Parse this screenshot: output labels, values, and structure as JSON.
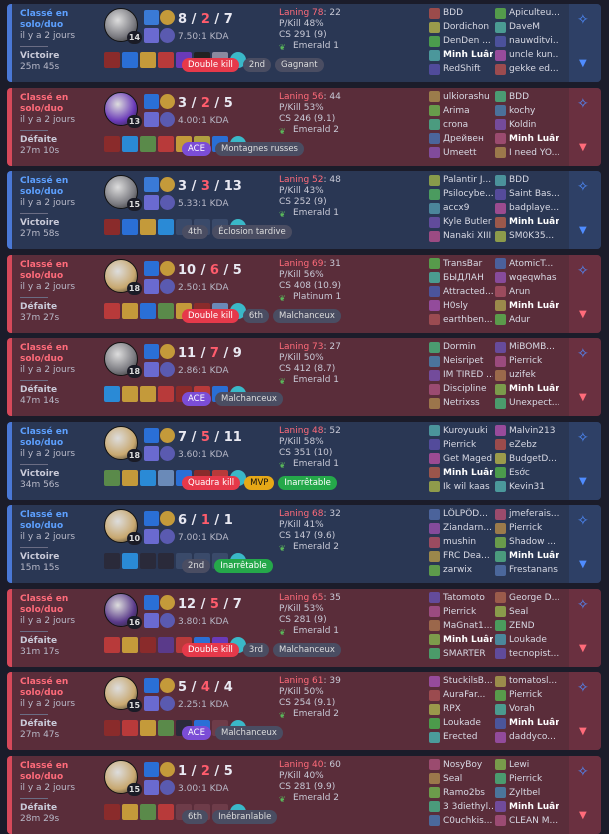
{
  "matches": [
    {
      "result": "win",
      "queue": "Classé en solo/duo",
      "ago": "il y a 2 jours",
      "outcome": "Victoire",
      "duration": "25m 45s",
      "level": "14",
      "kills": "8",
      "deaths": "2",
      "assists": "7",
      "kda_ratio": "7.50:1 KDA",
      "laning": "Laning 78",
      "laning_b": ": 22",
      "pkill": "P/Kill 48%",
      "cs": "CS 291 (9)",
      "rank": "Emerald 1",
      "badges": [
        {
          "t": "Double kill",
          "c": "red"
        },
        {
          "t": "2nd",
          "c": "grey"
        },
        {
          "t": "Gagnant",
          "c": "grey"
        }
      ],
      "team1": [
        "BDD",
        "Dordichon",
        "DenDen ...",
        "Minh Luân",
        "RedShift"
      ],
      "team2": [
        "Apiculteu...",
        "DaveM",
        "nauwditvi...",
        "uncle kun...",
        "gekke ed..."
      ],
      "items": [
        "#8a2b2b",
        "#2a6fd6",
        "#c49a3a",
        "#b83a3a",
        "#6a3ab8",
        "#222",
        "#8a8aa0"
      ],
      "ward": "#3ab8c8",
      "champ": "#7a7a80",
      "s1": "#3a7ad6",
      "s2": "#c49a3a"
    },
    {
      "result": "loss",
      "queue": "Classé en solo/duo",
      "ago": "il y a 2 jours",
      "outcome": "Défaite",
      "duration": "27m 10s",
      "level": "13",
      "kills": "3",
      "deaths": "2",
      "assists": "5",
      "kda_ratio": "4.00:1 KDA",
      "laning": "Laning 56",
      "laning_b": ": 44",
      "pkill": "P/Kill 53%",
      "cs": "CS 246 (9.1)",
      "rank": "Emerald 2",
      "badges": [
        {
          "t": "ACE",
          "c": "purple"
        },
        {
          "t": "Montagnes russes",
          "c": "grey"
        }
      ],
      "team1": [
        "ulkiorashu",
        "Arima",
        "crona",
        "Дрейвен",
        "Umeett"
      ],
      "team2": [
        "BDD",
        "kochy",
        "Koldin",
        "Minh Luân",
        "I need YO..."
      ],
      "items": [
        "#8a2b2b",
        "#2a8ad6",
        "#5a8a4a",
        "#b83a3a",
        "#c49a3a",
        "#b0a040",
        "#2a6fd6"
      ],
      "ward": "#3ab8c8",
      "champ": "#6a3ab8",
      "s1": "#2a6fd6",
      "s2": "#c49a3a"
    },
    {
      "result": "win",
      "queue": "Classé en solo/duo",
      "ago": "il y a 2 jours",
      "outcome": "Victoire",
      "duration": "27m 58s",
      "level": "15",
      "kills": "3",
      "deaths": "3",
      "assists": "13",
      "kda_ratio": "5.33:1 KDA",
      "laning": "Laning 52",
      "laning_b": ": 48",
      "pkill": "P/Kill 43%",
      "cs": "CS 252 (9)",
      "rank": "Emerald 1",
      "badges": [
        {
          "t": "4th",
          "c": "grey"
        },
        {
          "t": "Éclosion tardive",
          "c": "grey"
        }
      ],
      "team1": [
        "Palantir J...",
        "Psilocybe...",
        "accx9",
        "Kyle Butler",
        "Nanaki XIII"
      ],
      "team2": [
        "BDD",
        "Saint Bas...",
        "badplaye...",
        "Minh Luân",
        "SM0K35..."
      ],
      "items": [
        "#8a2b2b",
        "#2a6fd6",
        "#c49a3a",
        "#2a8ad6",
        "",
        "",
        ""
      ],
      "ward": "#3ab8c8",
      "champ": "#7a7a80",
      "s1": "#3a7ad6",
      "s2": "#c49a3a"
    },
    {
      "result": "loss",
      "queue": "Classé en solo/duo",
      "ago": "il y a 2 jours",
      "outcome": "Défaite",
      "duration": "37m 27s",
      "level": "18",
      "kills": "10",
      "deaths": "6",
      "assists": "5",
      "kda_ratio": "2.50:1 KDA",
      "laning": "Laning 69",
      "laning_b": ": 31",
      "pkill": "P/Kill 56%",
      "cs": "CS 408 (10.9)",
      "rank": "Platinum 1",
      "badges": [
        {
          "t": "Double kill",
          "c": "red"
        },
        {
          "t": "6th",
          "c": "grey"
        },
        {
          "t": "Malchanceux",
          "c": "grey"
        }
      ],
      "team1": [
        "TransBar",
        "БЫДЛАН",
        "Attracted...",
        "H0sly",
        "earthben..."
      ],
      "team2": [
        "AtomicT...",
        "wqeqwhas",
        "Arun",
        "Minh Luân",
        "Adur"
      ],
      "items": [
        "#b83a3a",
        "#c49a3a",
        "#2a6fd6",
        "#5a8a4a",
        "#c49a3a",
        "#8a2b2b",
        "#6a8ab8"
      ],
      "ward": "#3ab8c8",
      "champ": "#c8a870",
      "s1": "#2a6fd6",
      "s2": "#c49a3a"
    },
    {
      "result": "loss",
      "queue": "Classé en solo/duo",
      "ago": "il y a 2 jours",
      "outcome": "Défaite",
      "duration": "47m 14s",
      "level": "18",
      "kills": "11",
      "deaths": "7",
      "assists": "9",
      "kda_ratio": "2.86:1 KDA",
      "laning": "Laning 73",
      "laning_b": ": 27",
      "pkill": "P/Kill 50%",
      "cs": "CS 412 (8.7)",
      "rank": "Emerald 1",
      "badges": [
        {
          "t": "ACE",
          "c": "purple"
        },
        {
          "t": "Malchanceux",
          "c": "grey"
        }
      ],
      "team1": [
        "Dormin",
        "Neisripet",
        "IM TIRED ...",
        "Discipline",
        "Netrixss"
      ],
      "team2": [
        "MiBOMB...",
        "Pierrick",
        "uzifek",
        "Minh Luân",
        "Unexpect..."
      ],
      "items": [
        "#2a8ad6",
        "#c49a3a",
        "#c49a3a",
        "#b83a3a",
        "#8a2b2b",
        "#b83a3a",
        "#2a6fd6"
      ],
      "ward": "#3ab8c8",
      "champ": "#7a7a80",
      "s1": "#2a6fd6",
      "s2": "#c49a3a"
    },
    {
      "result": "win",
      "queue": "Classé en solo/duo",
      "ago": "il y a 2 jours",
      "outcome": "Victoire",
      "duration": "34m 56s",
      "level": "18",
      "kills": "7",
      "deaths": "5",
      "assists": "11",
      "kda_ratio": "3.60:1 KDA",
      "laning": "Laning 48",
      "laning_b": ": 52",
      "pkill": "P/Kill 58%",
      "cs": "CS 351 (10)",
      "rank": "Emerald 1",
      "badges": [
        {
          "t": "Quadra kill",
          "c": "red"
        },
        {
          "t": "MVP",
          "c": "gold"
        },
        {
          "t": "Inarrêtable",
          "c": "green"
        }
      ],
      "team1": [
        "Kuroyuuki",
        "Pierrick",
        "Get Maged",
        "Minh Luân",
        "Ik wil kaas"
      ],
      "team2": [
        "Malvin213",
        "eZebz",
        "BudgetD...",
        "Esớc",
        "Kevin31"
      ],
      "items": [
        "#5a8a4a",
        "#c49a3a",
        "#2a8ad6",
        "#6a8ab8",
        "#2a6fd6",
        "#8a2b2b",
        "#b83a3a"
      ],
      "ward": "#3ab8c8",
      "champ": "#c8a870",
      "s1": "#2a6fd6",
      "s2": "#c49a3a"
    },
    {
      "result": "win",
      "queue": "Classé en solo/duo",
      "ago": "il y a 2 jours",
      "outcome": "Victoire",
      "duration": "15m 15s",
      "level": "10",
      "kills": "6",
      "deaths": "1",
      "assists": "1",
      "kda_ratio": "7.00:1 KDA",
      "laning": "Laning 68",
      "laning_b": ": 32",
      "pkill": "P/Kill 41%",
      "cs": "CS 147 (9.6)",
      "rank": "Emerald 2",
      "badges": [
        {
          "t": "2nd",
          "c": "grey"
        },
        {
          "t": "Inarrêtable",
          "c": "green"
        }
      ],
      "team1": [
        "LÖLPÖD...",
        "Ziandarn...",
        "mushin",
        "FRC Dea...",
        "zarwix"
      ],
      "team2": [
        "jmeferais...",
        "Pierrick",
        "Shadow ...",
        "Minh Luân",
        "Frestanans"
      ],
      "items": [
        "#2a2a3a",
        "#2a8ad6",
        "#2a2a3a",
        "#2a2a3a",
        "",
        "",
        ""
      ],
      "ward": "#3ab8c8",
      "champ": "#c8a870",
      "s1": "#2a6fd6",
      "s2": "#c49a3a"
    },
    {
      "result": "loss",
      "queue": "Classé en solo/duo",
      "ago": "il y a 2 jours",
      "outcome": "Défaite",
      "duration": "31m 17s",
      "level": "16",
      "kills": "12",
      "deaths": "5",
      "assists": "7",
      "kda_ratio": "3.80:1 KDA",
      "laning": "Laning 65",
      "laning_b": ": 35",
      "pkill": "P/Kill 53%",
      "cs": "CS 281 (9)",
      "rank": "Emerald 1",
      "badges": [
        {
          "t": "Double kill",
          "c": "red"
        },
        {
          "t": "3rd",
          "c": "grey"
        },
        {
          "t": "Malchanceux",
          "c": "grey"
        }
      ],
      "team1": [
        "Tatomoto",
        "Pierrick",
        "MaGnat1...",
        "Minh Luân",
        "SMARTER"
      ],
      "team2": [
        "George D...",
        "Seal",
        "ZEND",
        "Loukade",
        "tecnopist..."
      ],
      "items": [
        "#b83a3a",
        "#c49a3a",
        "#8a2b2b",
        "#5a3a8a",
        "#b83a3a",
        "#2a6fd6",
        "#6a3ab8"
      ],
      "ward": "#3ab8c8",
      "champ": "#5a3a8a",
      "s1": "#2a6fd6",
      "s2": "#c49a3a"
    },
    {
      "result": "loss",
      "queue": "Classé en solo/duo",
      "ago": "il y a 2 jours",
      "outcome": "Défaite",
      "duration": "27m 47s",
      "level": "15",
      "kills": "5",
      "deaths": "4",
      "assists": "4",
      "kda_ratio": "2.25:1 KDA",
      "laning": "Laning 61",
      "laning_b": ": 39",
      "pkill": "P/Kill 50%",
      "cs": "CS 254 (9.1)",
      "rank": "Emerald 2",
      "badges": [
        {
          "t": "ACE",
          "c": "purple"
        },
        {
          "t": "Malchanceux",
          "c": "grey"
        }
      ],
      "team1": [
        "StuckilsB...",
        "AuraFar...",
        "RPX",
        "Loukade",
        "Erected"
      ],
      "team2": [
        "tomatosl...",
        "Pierrick",
        "Vorah",
        "Minh Luân",
        "daddyco..."
      ],
      "items": [
        "#8a2b2b",
        "#b83a3a",
        "#c49a3a",
        "#5a8a4a",
        "#2a2a3a",
        "#2a6fd6",
        ""
      ],
      "ward": "#3ab8c8",
      "champ": "#c8a870",
      "s1": "#2a6fd6",
      "s2": "#c49a3a"
    },
    {
      "result": "loss",
      "queue": "Classé en solo/duo",
      "ago": "il y a 2 jours",
      "outcome": "Défaite",
      "duration": "28m 29s",
      "level": "15",
      "kills": "1",
      "deaths": "2",
      "assists": "5",
      "kda_ratio": "3.00:1 KDA",
      "laning": "Laning 40",
      "laning_b": ": 60",
      "pkill": "P/Kill 40%",
      "cs": "CS 281 (9.9)",
      "rank": "Emerald 2",
      "badges": [
        {
          "t": "6th",
          "c": "grey"
        },
        {
          "t": "Inébranlable",
          "c": "grey"
        }
      ],
      "team1": [
        "NosyBoy",
        "Seal",
        "Ramo2bs",
        "3 3diethyl...",
        "C0uchkis..."
      ],
      "team2": [
        "Lewi",
        "Pierrick",
        "Zyltbel",
        "Minh Luân",
        "CLEAN M..."
      ],
      "items": [
        "#8a2b2b",
        "#c49a3a",
        "#5a8a4a",
        "#b83a3a",
        "",
        "",
        ""
      ],
      "ward": "#3ab8c8",
      "champ": "#c8a870",
      "s1": "#2a6fd6",
      "s2": "#c49a3a"
    }
  ],
  "icons": {
    "favorite": "sparkle-plus-icon",
    "expand": "chevron-down-icon",
    "rank": "laurel-icon"
  }
}
